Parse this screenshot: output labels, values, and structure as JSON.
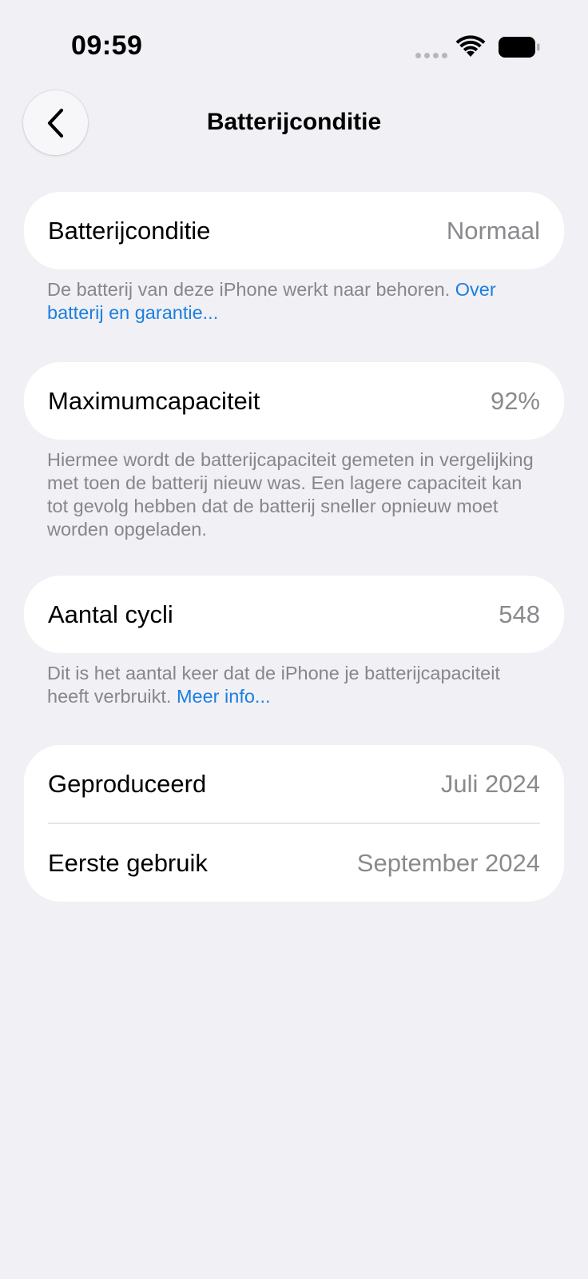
{
  "status_bar": {
    "time": "09:59",
    "icons": [
      "signal-dots-icon",
      "wifi-icon",
      "battery-icon"
    ]
  },
  "nav": {
    "back_icon": "chevron-left-icon",
    "title": "Batterijconditie"
  },
  "sections": {
    "condition": {
      "label": "Batterijconditie",
      "value": "Normaal",
      "footer_text": "De batterij van deze iPhone werkt naar behoren. ",
      "footer_link": "Over batterij en garantie..."
    },
    "capacity": {
      "label": "Maximumcapaciteit",
      "value": "92%",
      "footer_text": "Hiermee wordt de batterijcapaciteit gemeten in vergelijking met toen de batterij nieuw was. Een lagere capaciteit kan tot gevolg hebben dat de batterij sneller opnieuw moet worden opgeladen."
    },
    "cycles": {
      "label": "Aantal cycli",
      "value": "548",
      "footer_text": "Dit is het aantal keer dat de iPhone je batterijcapaciteit heeft verbruikt. ",
      "footer_link": "Meer info..."
    },
    "dates": {
      "manufactured_label": "Geproduceerd",
      "manufactured_value": "Juli 2024",
      "first_use_label": "Eerste gebruik",
      "first_use_value": "September 2024"
    }
  },
  "colors": {
    "background": "#f0f0f5",
    "card": "#ffffff",
    "secondary_text": "#8a8a8e",
    "link": "#1c7fe0"
  }
}
